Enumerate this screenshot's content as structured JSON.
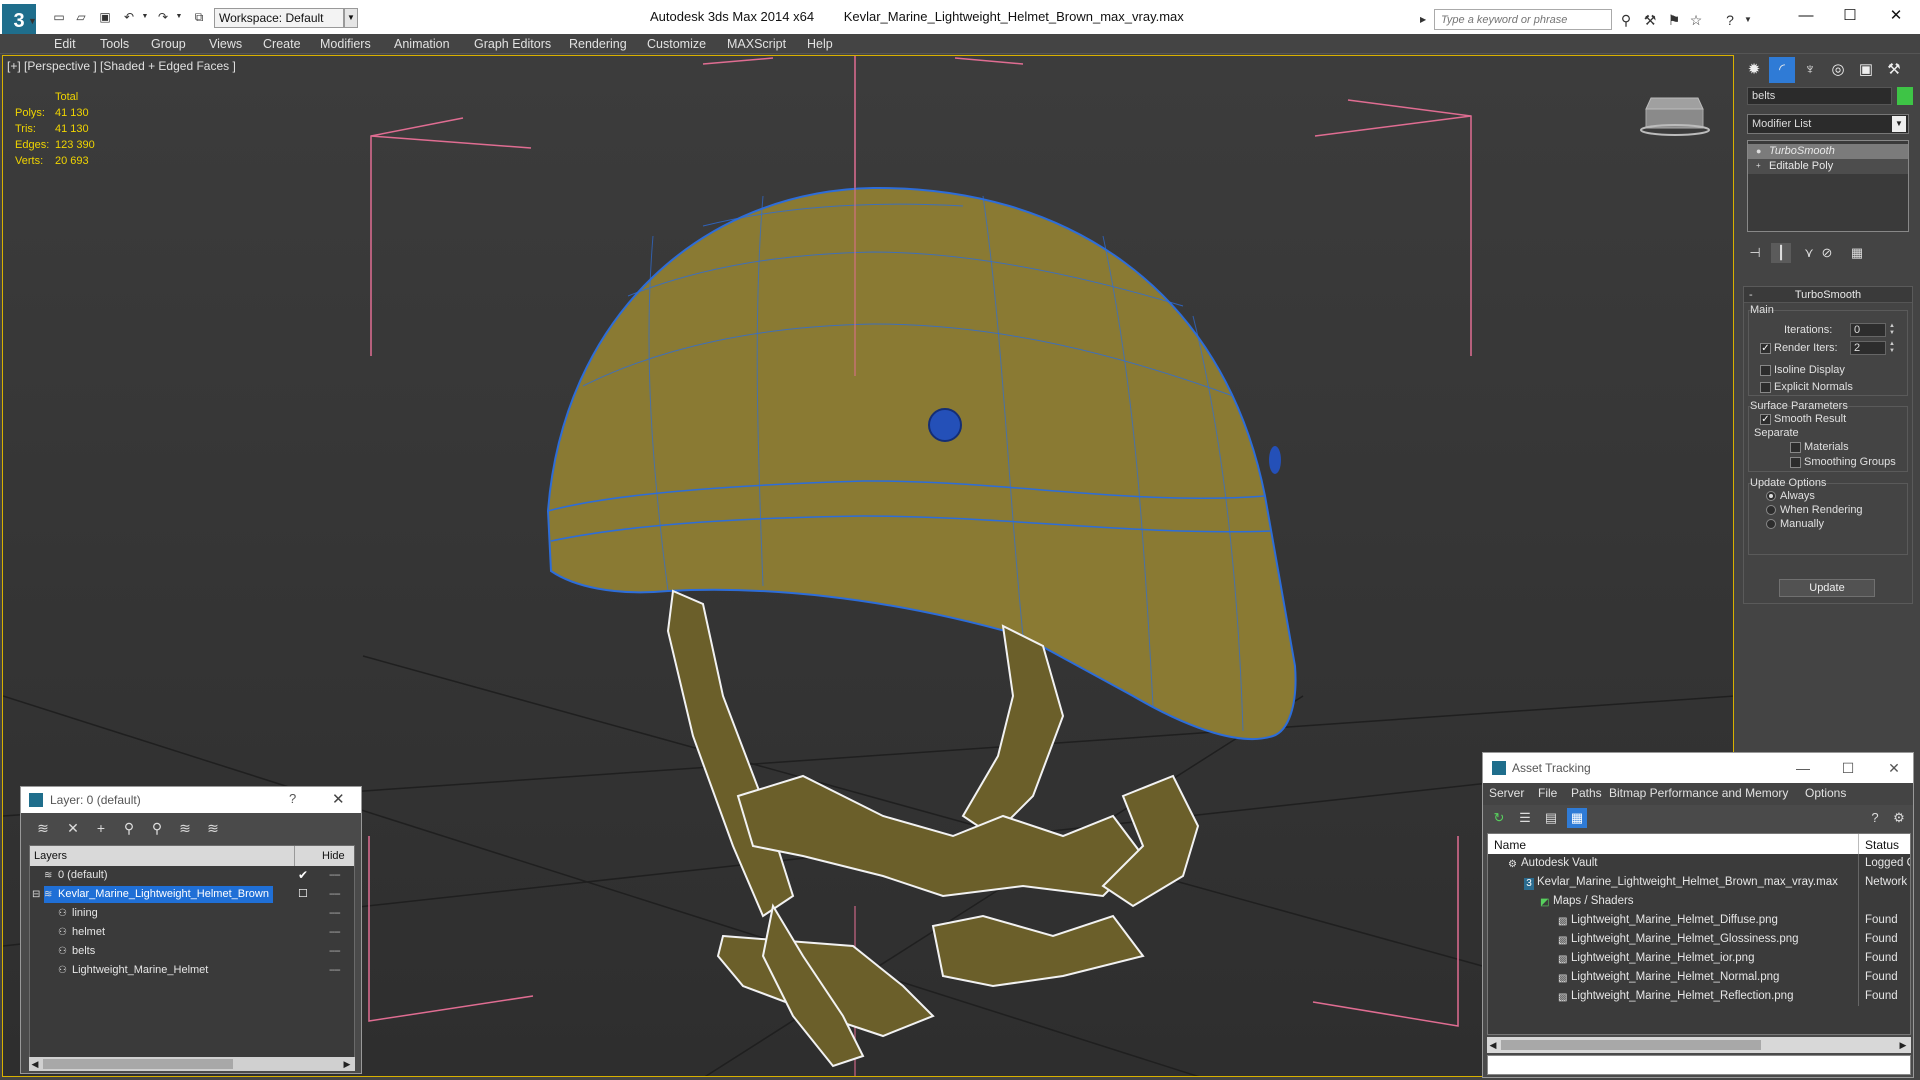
{
  "titlebar": {
    "app_name": "Autodesk 3ds Max  2014 x64",
    "file_name": "Kevlar_Marine_Lightweight_Helmet_Brown_max_vray.max",
    "workspace": "Workspace: Default",
    "search_placeholder": "Type a keyword or phrase"
  },
  "menu": [
    "Edit",
    "Tools",
    "Group",
    "Views",
    "Create",
    "Modifiers",
    "Animation",
    "Graph Editors",
    "Rendering",
    "Customize",
    "MAXScript",
    "Help"
  ],
  "viewport": {
    "label": "[+] [Perspective ] [Shaded + Edged Faces ]",
    "stats": {
      "total_label": "Total",
      "rows": [
        {
          "k": "Polys:",
          "v": "41 130"
        },
        {
          "k": "Tris:",
          "v": "41 130"
        },
        {
          "k": "Edges:",
          "v": "123 390"
        },
        {
          "k": "Verts:",
          "v": "20 693"
        }
      ]
    }
  },
  "command_panel": {
    "object_name": "belts",
    "object_color": "#3ec446",
    "modifier_list": "Modifier List",
    "stack": [
      "TurboSmooth",
      "Editable Poly"
    ],
    "rollout_title": "TurboSmooth",
    "main_label": "Main",
    "iterations_label": "Iterations:",
    "iterations_value": "0",
    "render_iters_label": "Render Iters:",
    "render_iters_value": "2",
    "isoline_label": "Isoline Display",
    "explicit_normals_label": "Explicit Normals",
    "surface_params_label": "Surface Parameters",
    "smooth_result_label": "Smooth Result",
    "separate_label": "Separate",
    "materials_label": "Materials",
    "smoothing_groups_label": "Smoothing Groups",
    "update_options_label": "Update Options",
    "always_label": "Always",
    "when_rendering_label": "When Rendering",
    "manually_label": "Manually",
    "update_button": "Update"
  },
  "layer_dialog": {
    "title": "Layer: 0 (default)",
    "help": "?",
    "col_layers": "Layers",
    "col_hide": "Hide",
    "rows": [
      {
        "name": "0 (default)",
        "indent": 14,
        "icon": "layer-icon"
      },
      {
        "name": "Kevlar_Marine_Lightweight_Helmet_Brown",
        "indent": 0,
        "icon": "layer-icon"
      },
      {
        "name": "lining",
        "indent": 28,
        "icon": "object-icon"
      },
      {
        "name": "helmet",
        "indent": 28,
        "icon": "object-icon"
      },
      {
        "name": "belts",
        "indent": 28,
        "icon": "object-icon"
      },
      {
        "name": "Lightweight_Marine_Helmet",
        "indent": 28,
        "icon": "object-icon"
      }
    ]
  },
  "asset_tracking": {
    "title": "Asset Tracking",
    "menu": [
      "Server",
      "File",
      "Paths",
      "Bitmap Performance and Memory",
      "Options"
    ],
    "col_name": "Name",
    "col_status": "Status",
    "rows": [
      {
        "name": "Autodesk Vault",
        "status": "Logged Ou"
      },
      {
        "name": "Kevlar_Marine_Lightweight_Helmet_Brown_max_vray.max",
        "status": "Network P"
      },
      {
        "name": "Maps / Shaders",
        "status": ""
      },
      {
        "name": "Lightweight_Marine_Helmet_Diffuse.png",
        "status": "Found"
      },
      {
        "name": "Lightweight_Marine_Helmet_Glossiness.png",
        "status": "Found"
      },
      {
        "name": "Lightweight_Marine_Helmet_ior.png",
        "status": "Found"
      },
      {
        "name": "Lightweight_Marine_Helmet_Normal.png",
        "status": "Found"
      },
      {
        "name": "Lightweight_Marine_Helmet_Reflection.png",
        "status": "Found"
      }
    ]
  }
}
